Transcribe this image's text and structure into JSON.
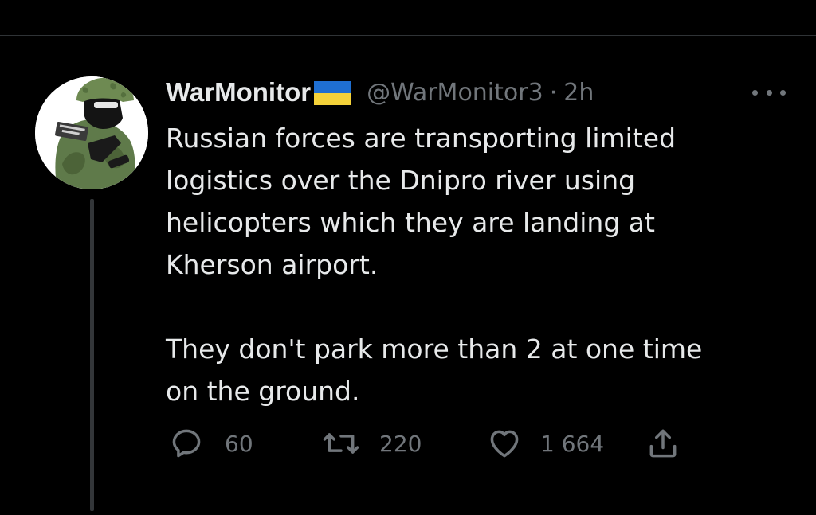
{
  "tweet": {
    "author": {
      "display_name": "WarMonitor",
      "handle": "@WarMonitor3",
      "separator": "·",
      "time": "2h",
      "flag_colors": {
        "top": "#1f6fd1",
        "bottom": "#f4d23a"
      }
    },
    "text_lines_paragraph1": [
      "Russian forces are transporting limited",
      "logistics over the Dnipro river using",
      "helicopters which they are landing at",
      "Kherson airport."
    ],
    "text_lines_paragraph2": [
      "They don't park more than 2 at one time",
      "on the ground."
    ],
    "actions": {
      "reply": {
        "icon": "reply-icon",
        "count": "60"
      },
      "retweet": {
        "icon": "retweet-icon",
        "count": "220"
      },
      "like": {
        "icon": "heart-icon",
        "count": "1 664"
      },
      "share": {
        "icon": "share-icon"
      }
    },
    "more_icon": "more-icon"
  },
  "theme": {
    "background": "#000000",
    "text": "#e7e9ea",
    "muted": "#71767b",
    "divider": "#2f3336"
  }
}
